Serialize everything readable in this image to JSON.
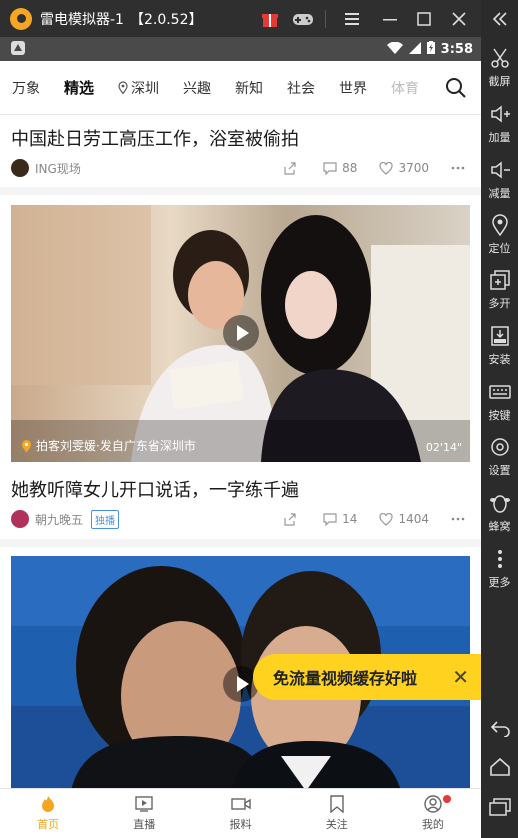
{
  "emulator": {
    "app_name": "雷电模拟器-1",
    "version": "【2.0.52】"
  },
  "sidebar": {
    "items": [
      {
        "label": "截屏",
        "icon": "scissors-icon"
      },
      {
        "label": "加量",
        "icon": "volume-up-icon"
      },
      {
        "label": "减量",
        "icon": "volume-down-icon"
      },
      {
        "label": "定位",
        "icon": "location-icon"
      },
      {
        "label": "多开",
        "icon": "multi-instance-icon"
      },
      {
        "label": "安装",
        "icon": "apk-install-icon"
      },
      {
        "label": "按键",
        "icon": "keyboard-icon"
      },
      {
        "label": "设置",
        "icon": "gear-icon"
      },
      {
        "label": "蜂窝",
        "icon": "beehive-icon"
      },
      {
        "label": "更多",
        "icon": "more-icon"
      }
    ]
  },
  "statusbar": {
    "time": "3:58"
  },
  "channels": [
    "万象",
    "精选",
    "深圳",
    "兴趣",
    "新知",
    "社会",
    "世界",
    "体育"
  ],
  "feed": [
    {
      "title": "中国赴日劳工高压工作，浴室被偷拍",
      "author": "ING现场",
      "comments": "88",
      "likes": "3700"
    },
    {
      "title": "她教听障女儿开口说话，一字练千遍",
      "author": "朝九晚五",
      "tag": "独播",
      "location": "拍客刘雯媛·发自广东省深圳市",
      "duration": "02'14\"",
      "comments": "14",
      "likes": "1404"
    }
  ],
  "toast": {
    "text": "免流量视频缓存好啦"
  },
  "bottom_tabs": [
    "首页",
    "直播",
    "报料",
    "关注",
    "我的"
  ],
  "colors": {
    "accent": "#f5a623",
    "toast": "#ffd21f",
    "tag": "#4a90e2",
    "badge": "#e53935"
  }
}
